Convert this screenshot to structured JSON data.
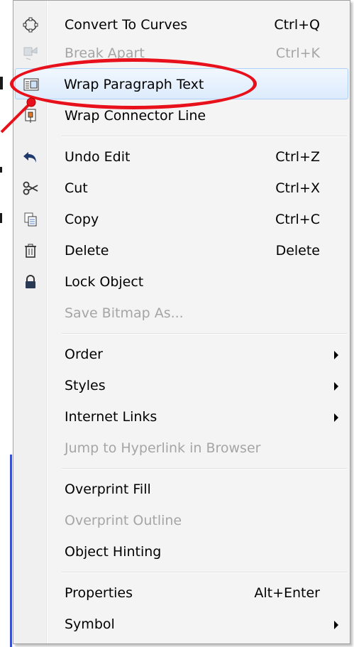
{
  "menu": {
    "items": [
      {
        "label": "Convert To Curves",
        "shortcut": "Ctrl+Q",
        "icon": "convert-curves-icon",
        "enabled": true
      },
      {
        "label": "Break Apart",
        "shortcut": "Ctrl+K",
        "icon": "break-apart-icon",
        "enabled": false
      },
      {
        "label": "Wrap Paragraph Text",
        "shortcut": "",
        "icon": "wrap-paragraph-icon",
        "enabled": true
      },
      {
        "label": "Wrap Connector Line",
        "shortcut": "",
        "icon": "wrap-connector-icon",
        "enabled": true
      },
      {
        "label": "Undo Edit",
        "shortcut": "Ctrl+Z",
        "icon": "undo-icon",
        "enabled": true
      },
      {
        "label": "Cut",
        "shortcut": "Ctrl+X",
        "icon": "scissors-icon",
        "enabled": true
      },
      {
        "label": "Copy",
        "shortcut": "Ctrl+C",
        "icon": "copy-icon",
        "enabled": true
      },
      {
        "label": "Delete",
        "shortcut": "Delete",
        "icon": "trash-icon",
        "enabled": true
      },
      {
        "label": "Lock Object",
        "shortcut": "",
        "icon": "lock-icon",
        "enabled": true
      },
      {
        "label": "Save Bitmap As...",
        "shortcut": "",
        "icon": "",
        "enabled": false
      },
      {
        "label": "Order",
        "shortcut": "",
        "submenu": true,
        "enabled": true
      },
      {
        "label": "Styles",
        "shortcut": "",
        "submenu": true,
        "enabled": true
      },
      {
        "label": "Internet Links",
        "shortcut": "",
        "submenu": true,
        "enabled": true
      },
      {
        "label": "Jump to Hyperlink in Browser",
        "shortcut": "",
        "enabled": false
      },
      {
        "label": "Overprint Fill",
        "shortcut": "",
        "enabled": true
      },
      {
        "label": "Overprint Outline",
        "shortcut": "",
        "enabled": false
      },
      {
        "label": "Object Hinting",
        "shortcut": "",
        "enabled": true
      },
      {
        "label": "Properties",
        "shortcut": "Alt+Enter",
        "enabled": true
      },
      {
        "label": "Symbol",
        "shortcut": "",
        "submenu": true,
        "enabled": true
      }
    ]
  },
  "colors": {
    "highlight_border": "#aecff7",
    "annotation": "#e8101a",
    "disabled_text": "#a5a5a5"
  }
}
